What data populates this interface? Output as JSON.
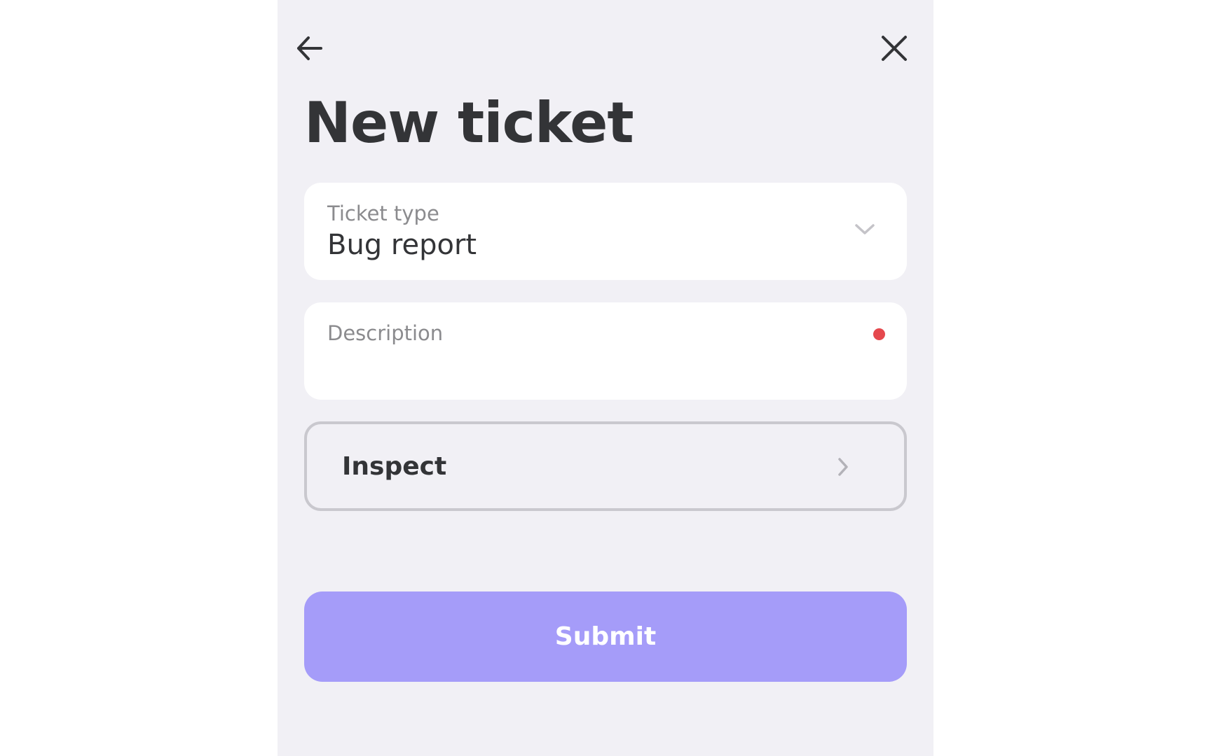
{
  "header": {
    "back_icon": "arrow-left-icon",
    "close_icon": "close-icon",
    "title": "New ticket"
  },
  "form": {
    "ticket_type": {
      "label": "Ticket type",
      "value": "Bug report",
      "icon": "chevron-down-icon"
    },
    "description": {
      "label": "Description",
      "value": "",
      "required": true,
      "required_indicator_color": "#e5484d"
    },
    "inspect": {
      "label": "Inspect",
      "icon": "chevron-right-icon"
    },
    "submit": {
      "label": "Submit",
      "color": "#a59cf9"
    }
  }
}
